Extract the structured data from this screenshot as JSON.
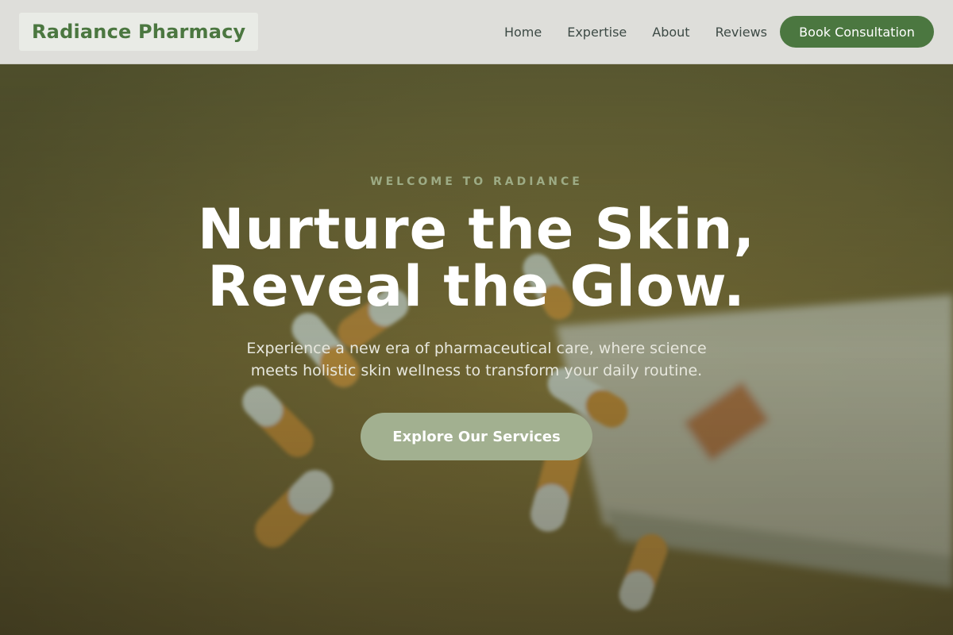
{
  "header": {
    "logo": "Radiance Pharmacy",
    "nav": [
      "Home",
      "Expertise",
      "About",
      "Reviews"
    ],
    "cta": "Book Consultation"
  },
  "hero": {
    "eyebrow": "WELCOME TO RADIANCE",
    "headline_line1": "Nurture the Skin,",
    "headline_line2": "Reveal the Glow.",
    "subline_line1": "Experience a new era of pharmaceutical care, where science",
    "subline_line2": "meets holistic skin wellness to transform your daily routine.",
    "cta": "Explore Our Services",
    "background_image": "pills-spilled-from-bottle"
  },
  "colors": {
    "brand_green": "#4b7740",
    "hero_button": "#a2b090",
    "header_bg": "#dededa"
  }
}
